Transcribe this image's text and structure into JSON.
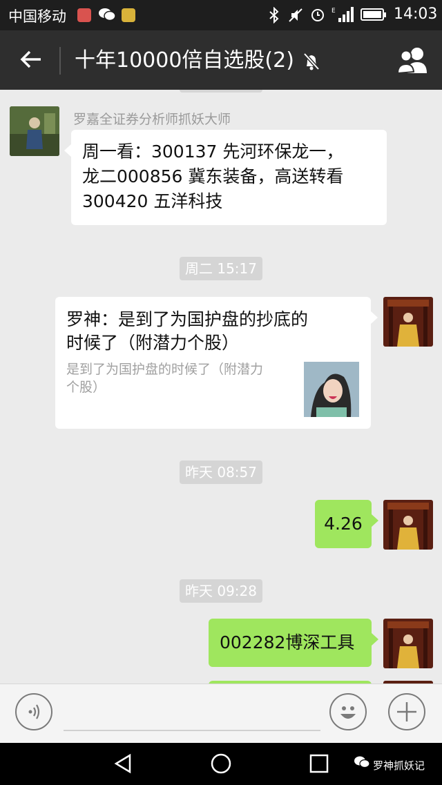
{
  "status_bar": {
    "carrier": "中国移动",
    "time": "14:03"
  },
  "header": {
    "title": "十年10000倍自选股(2)"
  },
  "messages": [
    {
      "sender": "罗嘉全证券分析师抓妖大师",
      "text_lines": [
        "周一看：300137 先河环保龙一，",
        "龙二000856 冀东装备，高送转看",
        "300420 五洋科技"
      ]
    },
    {
      "link_title_lines": [
        "罗神：是到了为国护盘的抄底的",
        "时候了（附潜力个股）"
      ],
      "link_desc_lines": [
        "是到了为国护盘的时候了（附潜力",
        "个股）"
      ]
    },
    {
      "text": "4.26"
    },
    {
      "text": "002282博深工具"
    }
  ],
  "timestamps": [
    "周二 15:17",
    "昨天 08:57",
    "昨天 09:28"
  ],
  "watermark": "罗神抓妖记"
}
